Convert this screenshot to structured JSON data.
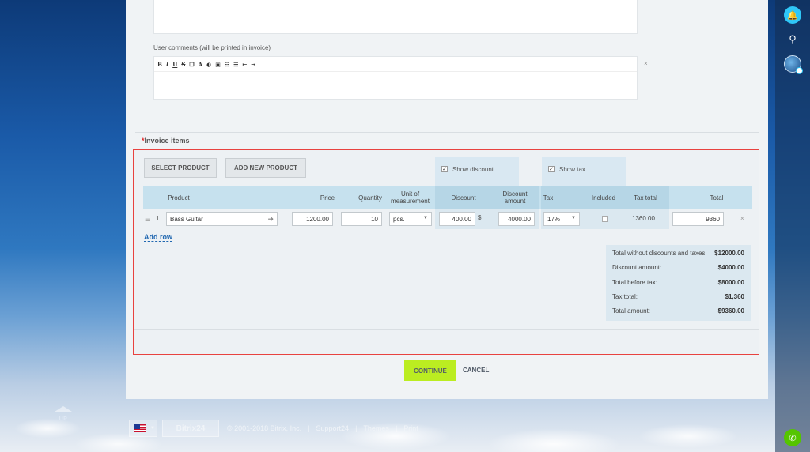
{
  "comments": {
    "label": "User comments (will be printed in invoice)",
    "toolbar": [
      "B",
      "I",
      "U",
      "S",
      "❐",
      "A",
      "◐",
      "▣",
      "☷",
      "☰",
      "⇤",
      "⇥"
    ],
    "close": "×"
  },
  "invoice": {
    "required_mark": "*",
    "title": "Invoice items",
    "select_product": "SELECT PRODUCT",
    "add_new_product": "ADD NEW PRODUCT",
    "show_discount": "Show discount",
    "show_tax": "Show tax",
    "columns": {
      "product": "Product",
      "price": "Price",
      "quantity": "Quantity",
      "unit": "Unit of measurement",
      "discount": "Discount",
      "discount_amount": "Discount amount",
      "tax": "Tax",
      "included": "Included",
      "tax_total": "Tax total",
      "total": "Total"
    },
    "row": {
      "num": "1.",
      "product": "Bass Guitar",
      "price": "1200.00",
      "quantity": "10",
      "unit": "pcs.",
      "discount": "400.00",
      "discount_unit": "$",
      "discount_amount": "4000.00",
      "tax": "17%",
      "tax_total": "1360.00",
      "total": "9360"
    },
    "add_row": "Add row",
    "totals": [
      {
        "label": "Total without discounts and taxes:",
        "value": "$12000.00"
      },
      {
        "label": "Discount amount:",
        "value": "$4000.00"
      },
      {
        "label": "Total before tax:",
        "value": "$8000.00"
      },
      {
        "label": "Tax total:",
        "value": "$1,360"
      },
      {
        "label": "Total amount:",
        "value": "$9360.00"
      }
    ]
  },
  "actions": {
    "continue": "CONTINUE",
    "cancel": "CANCEL"
  },
  "sidebar": {
    "up": "UP"
  },
  "footer": {
    "logo": "Bitrix24",
    "copyright": "© 2001-2018 Bitrix, Inc.",
    "support": "Support24",
    "themes": "Themes",
    "print": "Print"
  }
}
